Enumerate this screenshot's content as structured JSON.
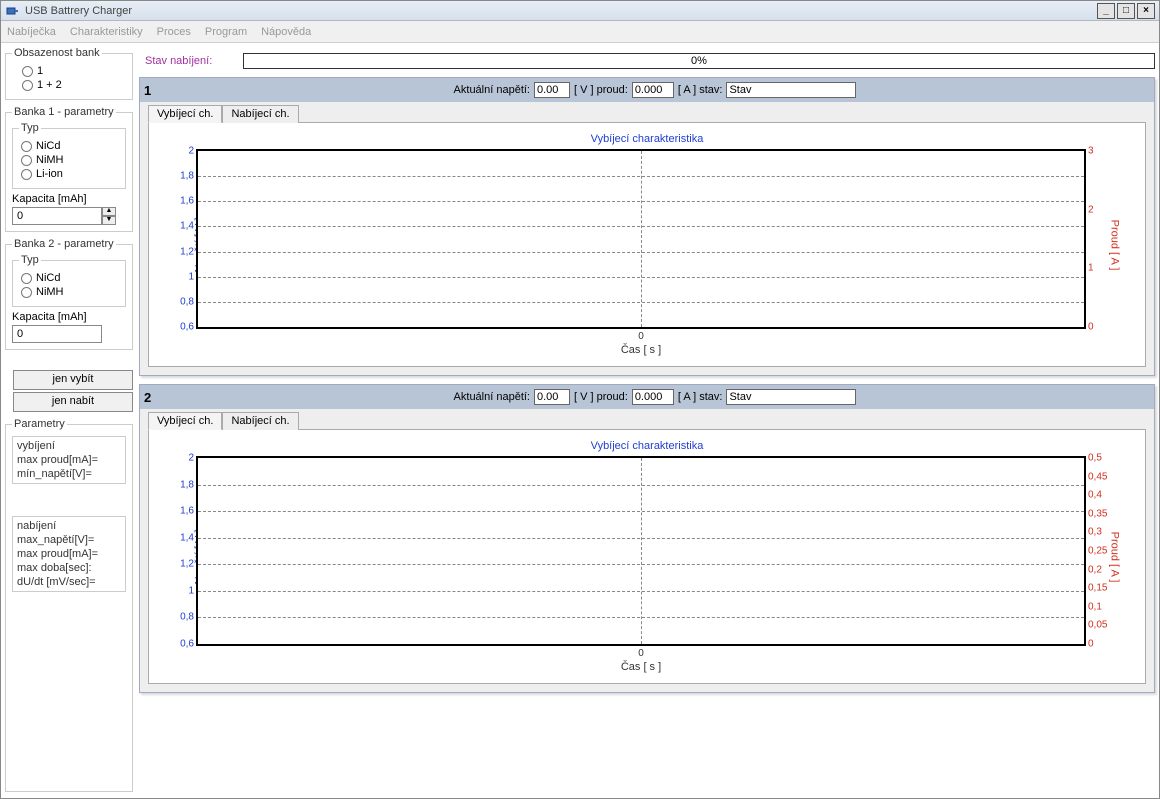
{
  "title": "USB Battrery Charger",
  "menu": [
    "Nabíječka",
    "Charakteristiky",
    "Proces",
    "Program",
    "Nápověda"
  ],
  "status": {
    "label": "Stav nabíjení:",
    "value": "0%"
  },
  "sidebar": {
    "obsazenost": {
      "legend": "Obsazenost bank",
      "opt1": "1",
      "opt2": "1 + 2"
    },
    "bank1": {
      "legend": "Banka 1 - parametry",
      "typ_legend": "Typ",
      "t1": "NiCd",
      "t2": "NiMH",
      "t3": "Li-ion",
      "kapacita_lbl": "Kapacita [mAh]",
      "kapacita_val": "0"
    },
    "bank2": {
      "legend": "Banka 2 - parametry",
      "typ_legend": "Typ",
      "t1": "NiCd",
      "t2": "NiMH",
      "kapacita_lbl": "Kapacita [mAh]",
      "kapacita_val": "0"
    },
    "btn_vybit": "jen vybít",
    "btn_nabit": "jen nabít",
    "parametry_legend": "Parametry",
    "vyb": {
      "h": "vybíjení",
      "l1": "max proud[mA]=",
      "l2": "mín_napětí[V]="
    },
    "nab": {
      "h": "nabíjení",
      "l1": "max_napětí[V]=",
      "l2": "max proud[mA]=",
      "l3": "max doba[sec]:",
      "l4": "dU/dt [mV/sec]="
    }
  },
  "panel_labels": {
    "aktualni_napeti": "Aktuální napětí:",
    "v_unit": "[ V ] proud:",
    "a_unit": "[ A ] stav:",
    "tab1": "Vybíjecí ch.",
    "tab2": "Nabíjecí ch."
  },
  "panels": [
    {
      "num": "1",
      "napeti": "0.00",
      "proud": "0.000",
      "stav": "Stav"
    },
    {
      "num": "2",
      "napeti": "0.00",
      "proud": "0.000",
      "stav": "Stav"
    }
  ],
  "chart_data": [
    {
      "type": "line",
      "title": "Vybíjecí charakteristika",
      "x": [
        0
      ],
      "xlabel": "Čas [ s ]",
      "ylabel_left": "Napětí [ V ]",
      "ylabel_right": "Proud [ A ]",
      "yticks_left": [
        2,
        1.8,
        1.6,
        1.4,
        1.2,
        1,
        0.8,
        0.6
      ],
      "ylim_left": [
        0.6,
        2.0
      ],
      "yticks_right": [
        3,
        2,
        1,
        0
      ],
      "ylim_right": [
        0,
        3
      ],
      "series": []
    },
    {
      "type": "line",
      "title": "Vybíjecí charakteristika",
      "x": [
        0
      ],
      "xlabel": "Čas [ s ]",
      "ylabel_left": "Napětí [ V ]",
      "ylabel_right": "Proud [ A ]",
      "yticks_left": [
        2,
        1.8,
        1.6,
        1.4,
        1.2,
        1,
        0.8,
        0.6
      ],
      "ylim_left": [
        0.6,
        2.0
      ],
      "yticks_right": [
        0.5,
        0.45,
        0.4,
        0.35,
        0.3,
        0.25,
        0.2,
        0.15,
        0.1,
        0.05,
        0
      ],
      "ylim_right": [
        0,
        0.5
      ],
      "series": []
    }
  ]
}
